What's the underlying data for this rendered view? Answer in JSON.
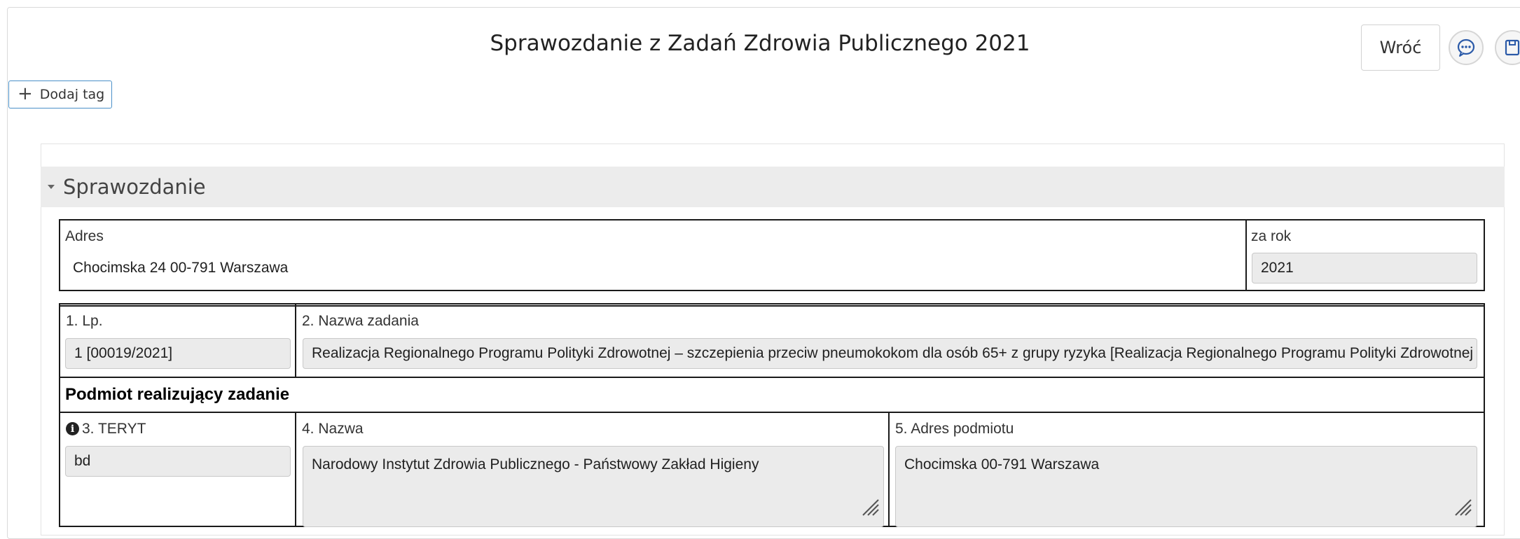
{
  "header": {
    "title": "Sprawozdanie z Zadań Zdrowia Publicznego 2021",
    "back_label": "Wróć",
    "add_tag_label": "Dodaj tag"
  },
  "section": {
    "title": "Sprawozdanie"
  },
  "address_block": {
    "address_label": "Adres",
    "address_value": "Chocimska 24 00-791 Warszawa",
    "year_label": "za rok",
    "year_value": "2021"
  },
  "task": {
    "lp_label": "1. Lp.",
    "lp_value": "1 [00019/2021]",
    "name_label": "2. Nazwa zadania",
    "name_value": "Realizacja Regionalnego Programu Polityki Zdrowotnej – szczepienia przeciw pneumokokom dla osób 65+ z grupy ryzyka [Realizacja Regionalnego Programu Polityki Zdrowotnej"
  },
  "entity": {
    "heading": "Podmiot realizujący zadanie",
    "teryt_label": "3. TERYT",
    "teryt_value": "bd",
    "name_label": "4. Nazwa",
    "name_value": "Narodowy Instytut Zdrowia Publicznego - Państwowy Zakład Higieny",
    "address_label": "5. Adres podmiotu",
    "address_value": "Chocimska  00-791 Warszawa"
  },
  "icons": {
    "comment": "comment-dots-icon",
    "save": "save-icon",
    "plus": "plus-icon",
    "info": "info-circle-icon",
    "caret": "caret-down-icon",
    "resize": "resize-handle-icon"
  }
}
